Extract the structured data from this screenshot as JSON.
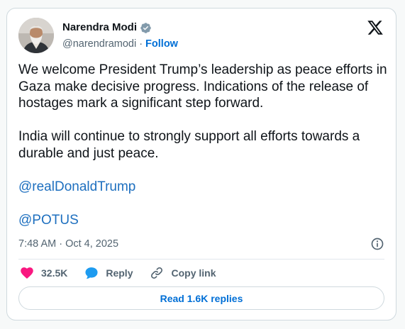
{
  "author": {
    "name": "Narendra Modi",
    "handle": "@narendramodi",
    "separator": "·",
    "follow_label": "Follow"
  },
  "tweet": {
    "paragraphs": [
      "We welcome President Trump’s leadership as peace efforts in Gaza make decisive progress. Indications of the release of hostages mark a significant step forward.",
      "India will continue to strongly support all efforts towards a durable and just peace."
    ],
    "mentions": [
      "@realDonaldTrump",
      "@POTUS"
    ],
    "timestamp": "7:48 AM · Oct 4, 2025"
  },
  "actions": {
    "likes": "32.5K",
    "reply_label": "Reply",
    "copy_link_label": "Copy link"
  },
  "read_replies_label": "Read 1.6K replies",
  "icons": {
    "verified": "verified-badge-icon",
    "logo": "x-logo-icon",
    "info": "info-icon",
    "like": "heart-icon",
    "reply": "speech-bubble-icon",
    "copy": "link-icon"
  },
  "colors": {
    "link": "#1d6fbf",
    "follow": "#006fd6",
    "heart": "#f91880",
    "reply_bubble": "#1d9bf0",
    "verified": "#829aab"
  }
}
